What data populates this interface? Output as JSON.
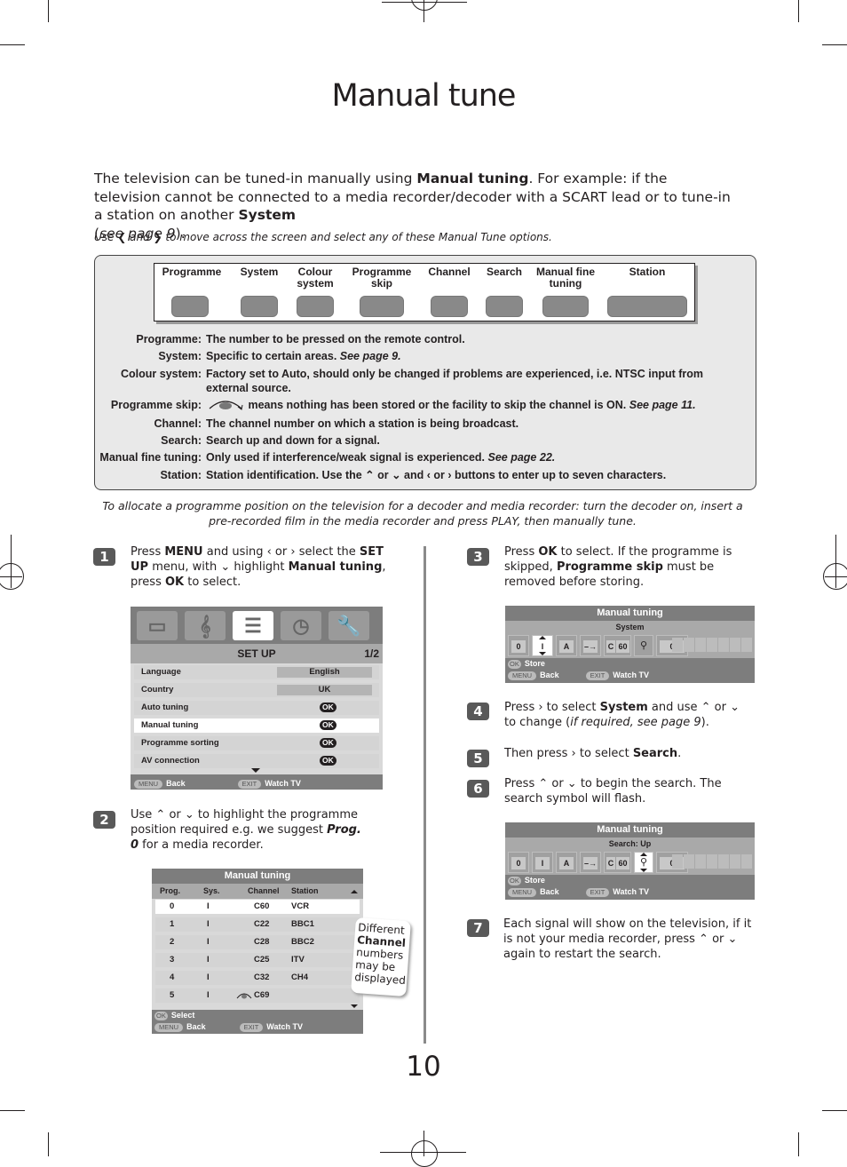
{
  "page": {
    "title": "Manual tune",
    "page_number": "10"
  },
  "intro": {
    "part1": "The television can be tuned-in manually using ",
    "bold1": "Manual tuning",
    "part2": ". For example: if the television cannot be connected to a media recorder/decoder with a SCART lead or to tune-in a station on another ",
    "bold2": "System",
    "part3": " (",
    "italic": "see page 9",
    "part4": ")."
  },
  "hint": {
    "pre": "Use ",
    "mid": " and ",
    "post": " to move across the screen and select any of these Manual Tune options."
  },
  "options": [
    {
      "label": "Programme"
    },
    {
      "label": "System"
    },
    {
      "label": "Colour system"
    },
    {
      "label": "Programme skip"
    },
    {
      "label": "Channel"
    },
    {
      "label": "Search"
    },
    {
      "label": "Manual fine tuning"
    },
    {
      "label": "Station"
    }
  ],
  "definitions": [
    {
      "term": "Programme:",
      "desc": "The number to be pressed on the remote control.",
      "ref": ""
    },
    {
      "term": "System:",
      "desc": "Specific to certain areas. ",
      "ref": "See page 9."
    },
    {
      "term": "Colour system:",
      "desc": "Factory set to Auto, should only be changed if problems are experienced, i.e. NTSC input from external source.",
      "ref": ""
    },
    {
      "term": "Programme skip:",
      "desc": " means nothing has been stored or the facility to skip the channel is ON. ",
      "ref": "See page 11."
    },
    {
      "term": "Channel:",
      "desc": "The channel number on which a station is being broadcast.",
      "ref": ""
    },
    {
      "term": "Search:",
      "desc": "Search up and down for a signal.",
      "ref": ""
    },
    {
      "term": "Manual fine tuning:",
      "desc": "Only used if interference/weak signal is experienced. ",
      "ref": "See page 22."
    },
    {
      "term": "Station:",
      "desc": "Station identification. Use the ⌃ or ⌄ and ‹ or › buttons to enter up to seven characters.",
      "ref": ""
    }
  ],
  "allocate_note": "To allocate a programme position on the television for a decoder and media recorder: turn the decoder on, insert a pre-recorded film in the media recorder and press PLAY, then manually tune.",
  "steps": [
    {
      "num": "1",
      "html_parts": [
        "Press ",
        "MENU",
        " and using ‹ or › select the ",
        "SET UP",
        " menu, with ⌄ highlight ",
        "Manual tuning",
        ", press ",
        "OK",
        " to select."
      ]
    },
    {
      "num": "2",
      "html_parts": [
        "Use ⌃ or ⌄ to highlight the programme position required e.g. we suggest ",
        "Prog. 0",
        " for a media recorder."
      ]
    },
    {
      "num": "3",
      "html_parts": [
        "Press ",
        "OK",
        " to select. If the programme is skipped, ",
        "Programme skip",
        " must be removed before storing."
      ]
    },
    {
      "num": "4",
      "html_parts": [
        "Press › to select ",
        "System",
        " and use ⌃ or ⌄ to change (",
        "if required, see page 9",
        ")."
      ]
    },
    {
      "num": "5",
      "html_parts": [
        "Then press › to select ",
        "Search",
        "."
      ]
    },
    {
      "num": "6",
      "html_parts": [
        "Press ⌃ or ⌄ to begin the search. The search symbol will flash."
      ]
    },
    {
      "num": "7",
      "html_parts": [
        "Each signal will show on the television, if it is not your media recorder, press ⌃ or ⌄ again to restart the search."
      ]
    }
  ],
  "setup_menu": {
    "icons": [
      "picture-icon",
      "sound-icon",
      "setup-icon",
      "timer-icon",
      "tools-icon"
    ],
    "title": "SET UP",
    "page": "1/2",
    "rows": [
      {
        "label": "Language",
        "value": "English",
        "type": "value"
      },
      {
        "label": "Country",
        "value": "UK",
        "type": "value"
      },
      {
        "label": "Auto tuning",
        "value": "OK",
        "type": "ok"
      },
      {
        "label": "Manual tuning",
        "value": "OK",
        "type": "ok",
        "selected": true
      },
      {
        "label": "Programme sorting",
        "value": "OK",
        "type": "ok"
      },
      {
        "label": "AV connection",
        "value": "OK",
        "type": "ok"
      }
    ],
    "footer": {
      "menu_key": "MENU",
      "back": "Back",
      "exit_key": "EXIT",
      "watch": "Watch TV"
    }
  },
  "tuning_list": {
    "title": "Manual tuning",
    "headers": [
      "Prog.",
      "Sys.",
      "Channel",
      "Station"
    ],
    "rows": [
      {
        "prog": "0",
        "sys": "I",
        "channel": "C60",
        "station": "VCR",
        "skip": false
      },
      {
        "prog": "1",
        "sys": "I",
        "channel": "C22",
        "station": "BBC1",
        "skip": false
      },
      {
        "prog": "2",
        "sys": "I",
        "channel": "C28",
        "station": "BBC2",
        "skip": false
      },
      {
        "prog": "3",
        "sys": "I",
        "channel": "C25",
        "station": "ITV",
        "skip": false
      },
      {
        "prog": "4",
        "sys": "I",
        "channel": "C32",
        "station": "CH4",
        "skip": false
      },
      {
        "prog": "5",
        "sys": "I",
        "channel": "C69",
        "station": "",
        "skip": true
      }
    ],
    "footer": {
      "ok_key": "OK",
      "select": "Select",
      "menu_key": "MENU",
      "back": "Back",
      "exit_key": "EXIT",
      "watch": "Watch TV"
    },
    "note": [
      "Different",
      "Channel",
      "numbers",
      "may be",
      "displayed"
    ]
  },
  "tuning_system": {
    "title": "Manual tuning",
    "subtitle": "System",
    "cells": [
      "0",
      "I",
      "A",
      "–→",
      "C",
      "60",
      "search",
      "0"
    ],
    "selected_index": 1,
    "footer": {
      "ok_key": "OK",
      "store": "Store",
      "menu_key": "MENU",
      "back": "Back",
      "exit_key": "EXIT",
      "watch": "Watch TV"
    }
  },
  "tuning_search": {
    "title": "Manual tuning",
    "subtitle": "Search: Up",
    "cells": [
      "0",
      "I",
      "A",
      "–→",
      "C",
      "60",
      "search",
      "0"
    ],
    "selected_index": 6,
    "footer": {
      "ok_key": "OK",
      "store": "Store",
      "menu_key": "MENU",
      "back": "Back",
      "exit_key": "EXIT",
      "watch": "Watch TV"
    }
  }
}
